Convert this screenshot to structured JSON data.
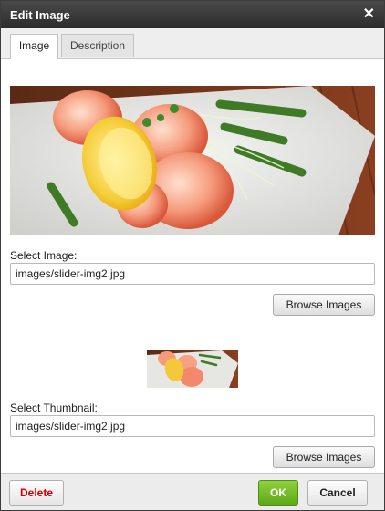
{
  "dialog": {
    "title": "Edit Image",
    "close_icon": "close-icon"
  },
  "tabs": [
    {
      "label": "Image",
      "active": true
    },
    {
      "label": "Description",
      "active": false
    }
  ],
  "image": {
    "label": "Select Image:",
    "value": "images/slider-img2.jpg",
    "browse_label": "Browse Images"
  },
  "thumbnail": {
    "label": "Select Thumbnail:",
    "value": "images/slider-img2.jpg",
    "browse_label": "Browse Images"
  },
  "footer": {
    "delete_label": "Delete",
    "ok_label": "OK",
    "cancel_label": "Cancel"
  },
  "colors": {
    "titlebar": "#333333",
    "delete_text": "#d40000",
    "ok_button": "#6bbb22"
  }
}
